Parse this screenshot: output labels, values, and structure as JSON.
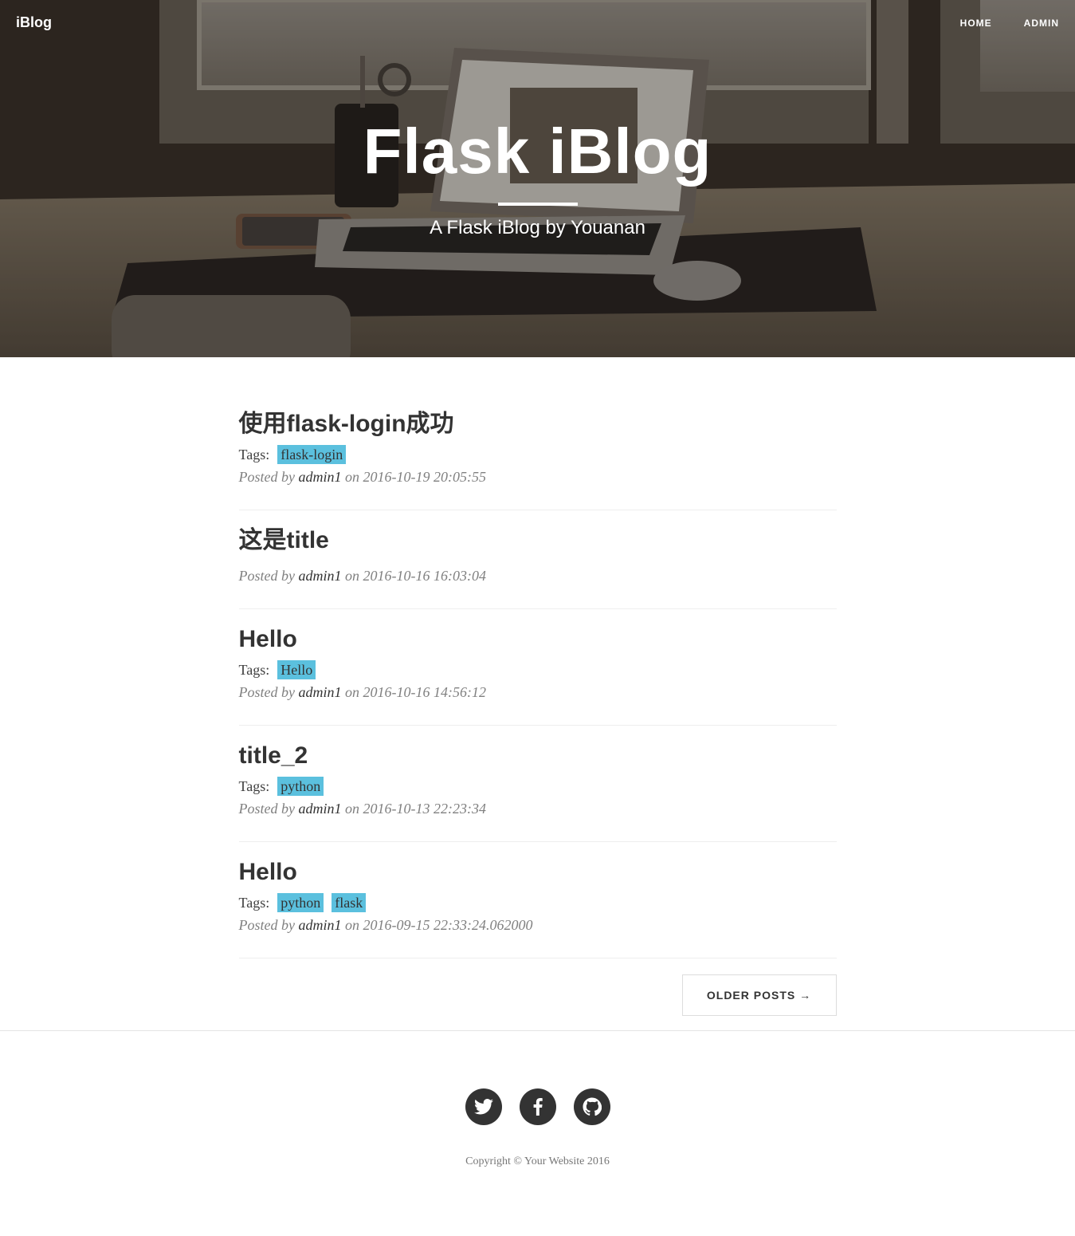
{
  "nav": {
    "brand": "iBlog",
    "links": [
      "HOME",
      "ADMIN"
    ]
  },
  "hero": {
    "title": "Flask iBlog",
    "subtitle": "A Flask iBlog by Youanan"
  },
  "posts": [
    {
      "title": "使用flask-login成功",
      "tags_label": "Tags:",
      "tags": [
        "flask-login"
      ],
      "posted_by": "Posted by",
      "author": "admin1",
      "date": "on 2016-10-19 20:05:55"
    },
    {
      "title": "这是title",
      "tags_label": "",
      "tags": [],
      "posted_by": "Posted by",
      "author": "admin1",
      "date": "on 2016-10-16 16:03:04"
    },
    {
      "title": "Hello",
      "tags_label": "Tags:",
      "tags": [
        "Hello"
      ],
      "posted_by": "Posted by",
      "author": "admin1",
      "date": "on 2016-10-16 14:56:12"
    },
    {
      "title": "title_2",
      "tags_label": "Tags:",
      "tags": [
        "python"
      ],
      "posted_by": "Posted by",
      "author": "admin1",
      "date": "on 2016-10-13 22:23:34"
    },
    {
      "title": "Hello",
      "tags_label": "Tags:",
      "tags": [
        "python",
        "flask"
      ],
      "posted_by": "Posted by",
      "author": "admin1",
      "date": "on 2016-09-15 22:33:24.062000"
    }
  ],
  "pager": {
    "older_label": "OLDER POSTS →"
  },
  "footer": {
    "social": [
      "twitter-icon",
      "facebook-icon",
      "github-icon"
    ],
    "copyright": "Copyright © Your Website 2016"
  },
  "colors": {
    "tag_bg": "#5bc0de",
    "heading": "#333333",
    "meta": "#808080"
  }
}
